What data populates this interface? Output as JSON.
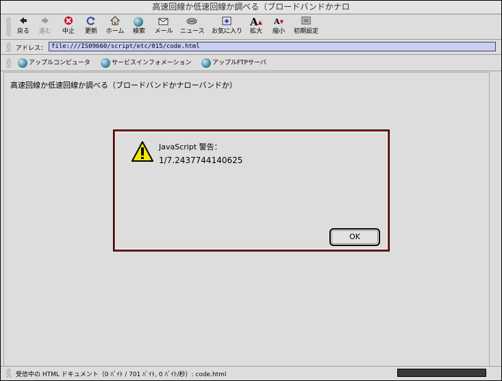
{
  "window": {
    "title": "高速回線か低速回線か調べる（ブロードバンドかナロ"
  },
  "toolbar": {
    "items": [
      {
        "label": "戻る",
        "icon": "back-arrow-icon"
      },
      {
        "label": "進む",
        "icon": "forward-arrow-icon"
      },
      {
        "label": "中止",
        "icon": "stop-icon"
      },
      {
        "label": "更新",
        "icon": "reload-icon"
      },
      {
        "label": "ホーム",
        "icon": "home-icon"
      },
      {
        "label": "検索",
        "icon": "search-globe-icon"
      },
      {
        "label": "メール",
        "icon": "mail-icon"
      },
      {
        "label": "ニュース",
        "icon": "news-icon"
      },
      {
        "label": "お気に入り",
        "icon": "favorites-icon"
      },
      {
        "label": "拡大",
        "icon": "text-larger-icon"
      },
      {
        "label": "縮小",
        "icon": "text-smaller-icon"
      },
      {
        "label": "初期設定",
        "icon": "preferences-icon"
      }
    ]
  },
  "address": {
    "label": "アドレス：",
    "value": "file:///IS09660/script/etc/015/code.html"
  },
  "favorites": [
    {
      "label": "アップルコンピュータ"
    },
    {
      "label": "サービスインフォメーション"
    },
    {
      "label": "アップルFTPサーバ"
    }
  ],
  "page": {
    "heading": "高速回線か低速回線か調べる（ブロードバンドかナローバンドか）"
  },
  "dialog": {
    "title": "JavaScript 警告：",
    "message": "1/7.2437744140625",
    "ok_label": "OK"
  },
  "status": {
    "text": "受信中の HTML ドキュメント（0 ﾊﾞｲﾄ / 701 ﾊﾞｲﾄ, 0 ﾊﾞｲﾄ/秒）: code.html"
  },
  "colors": {
    "address_bg": "#c9cdf5",
    "dialog_border": "#8b1e1e",
    "chrome": "#dddddd"
  }
}
